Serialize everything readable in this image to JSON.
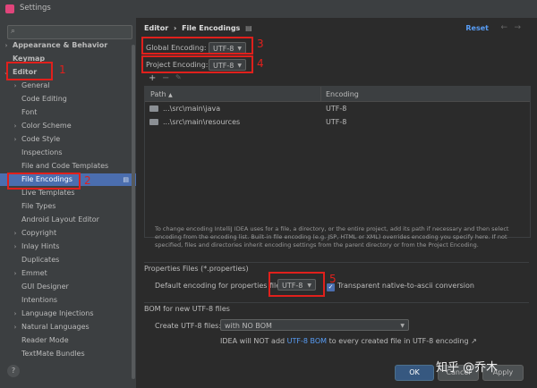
{
  "window": {
    "title": "Settings"
  },
  "sidebar": {
    "search_placeholder": "",
    "items": [
      {
        "label": "Appearance & Behavior",
        "chevron": "›",
        "bold": true
      },
      {
        "label": "Keymap",
        "chevron": "",
        "bold": true
      },
      {
        "label": "Editor",
        "chevron": "⌄",
        "bold": true
      },
      {
        "label": "General",
        "chevron": "›"
      },
      {
        "label": "Code Editing",
        "chevron": ""
      },
      {
        "label": "Font",
        "chevron": ""
      },
      {
        "label": "Color Scheme",
        "chevron": "›"
      },
      {
        "label": "Code Style",
        "chevron": "›"
      },
      {
        "label": "Inspections",
        "chevron": ""
      },
      {
        "label": "File and Code Templates",
        "chevron": ""
      },
      {
        "label": "File Encodings",
        "chevron": "",
        "selected": true
      },
      {
        "label": "Live Templates",
        "chevron": ""
      },
      {
        "label": "File Types",
        "chevron": ""
      },
      {
        "label": "Android Layout Editor",
        "chevron": ""
      },
      {
        "label": "Copyright",
        "chevron": "›"
      },
      {
        "label": "Inlay Hints",
        "chevron": "›"
      },
      {
        "label": "Duplicates",
        "chevron": ""
      },
      {
        "label": "Emmet",
        "chevron": "›"
      },
      {
        "label": "GUI Designer",
        "chevron": ""
      },
      {
        "label": "Intentions",
        "chevron": ""
      },
      {
        "label": "Language Injections",
        "chevron": "›"
      },
      {
        "label": "Natural Languages",
        "chevron": "›"
      },
      {
        "label": "Reader Mode",
        "chevron": ""
      },
      {
        "label": "TextMate Bundles",
        "chevron": ""
      }
    ],
    "help_label": "?"
  },
  "header": {
    "breadcrumb_root": "Editor",
    "breadcrumb_sep": "›",
    "breadcrumb_page": "File Encodings",
    "reset_label": "Reset"
  },
  "encodings": {
    "global_label": "Global Encoding:",
    "global_value": "UTF-8",
    "project_label": "Project Encoding:",
    "project_value": "UTF-8"
  },
  "table": {
    "columns": [
      "Path",
      "Encoding"
    ],
    "rows": [
      {
        "path": "...\\src\\main\\java",
        "encoding": "UTF-8"
      },
      {
        "path": "...\\src\\main\\resources",
        "encoding": "UTF-8"
      }
    ]
  },
  "hint": "To change encoding IntelliJ IDEA uses for a file, a directory, or the entire project, add its path if necessary and then select encoding from the encoding list. Built-in file encoding (e.g. JSP, HTML or XML) overrides encoding you specify here. If not specified, files and directories inherit encoding settings from the parent directory or from the Project Encoding.",
  "properties": {
    "section_title": "Properties Files (*.properties)",
    "default_label": "Default encoding for properties files:",
    "default_value": "UTF-8",
    "native_label": "Transparent native-to-ascii conversion",
    "native_checked": true
  },
  "bom": {
    "section_title": "BOM for new UTF-8 files",
    "create_label": "Create UTF-8 files:",
    "create_value": "with NO BOM",
    "note_prefix": "IDEA will NOT add",
    "note_link": "UTF-8 BOM",
    "note_suffix": "to every created file in UTF-8 encoding ↗"
  },
  "footer": {
    "ok_label": "OK",
    "cancel_label": "Cancel",
    "apply_label": "Apply"
  },
  "annotations": {
    "n1": "1",
    "n2": "2",
    "n3": "3",
    "n4": "4",
    "n5": "5",
    "color": "#e0201c"
  },
  "watermark": "知乎 @乔木"
}
